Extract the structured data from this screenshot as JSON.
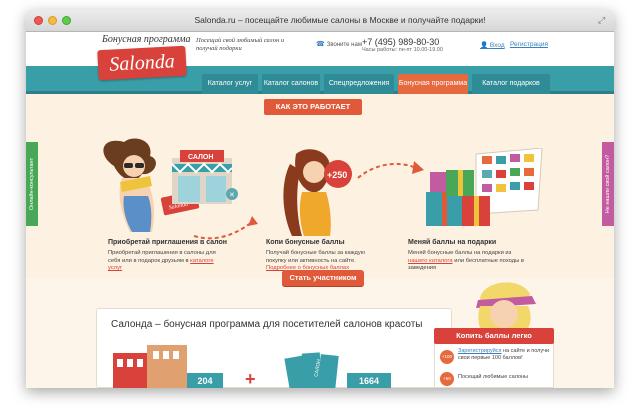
{
  "window": {
    "title": "Salonda.ru – посещайте любимые салоны в Москве и получайте подарки!"
  },
  "header": {
    "tagline": "Бонусная программа",
    "logo": "Salonda",
    "slogan": "Посещай свой любимый салон и получай подарки",
    "phone_label": "Звоните нам",
    "phone": "+7 (495) 989-80-30",
    "hours": "Часы работы: пн-пт 10.00-19.00",
    "login": "Вход",
    "register": "Регистрация"
  },
  "nav": [
    "Каталог услуг",
    "Каталог салонов",
    "Спецпредложения",
    "Бонусная программа",
    "Каталог подарков"
  ],
  "how": {
    "ribbon": "КАК ЭТО РАБОТАЕТ",
    "salon_sign": "САЛОН",
    "bonus_badge": "+250",
    "steps": [
      {
        "title": "Приобретай приглашения в салон",
        "text": "Приобретай приглашения в салоны для себя или в подарок друзьям в",
        "link": "каталоге услуг"
      },
      {
        "title": "Копи бонусные баллы",
        "text": "Получай бонусные баллы за каждую покупку или активность на сайте.",
        "link": "Подробнее о бонусных баллах"
      },
      {
        "title": "Меняй баллы на подарки",
        "text_pre": "Меняй бонусные баллы на подарки из",
        "link": "нашего каталога",
        "text_post": "или бесплатные походы в заведения"
      }
    ],
    "cta": "Стать участником"
  },
  "side_tabs": {
    "left": "Онлайн-консультант",
    "right": "Не нашли свой салон?"
  },
  "info": {
    "title": "Салонда – бонусная программа для посетителей салонов красоты",
    "num1": "204",
    "num2": "1664",
    "ticket_label": "САЛОН"
  },
  "promo": {
    "ribbon": "Копить баллы легко",
    "badge1": "+100",
    "item1_link": "Зарегистрируйся",
    "item1_text": "на сайте и получи свои первые 100 баллов!",
    "badge2": "+50",
    "item2_text": "Посещай любимые салоны"
  }
}
